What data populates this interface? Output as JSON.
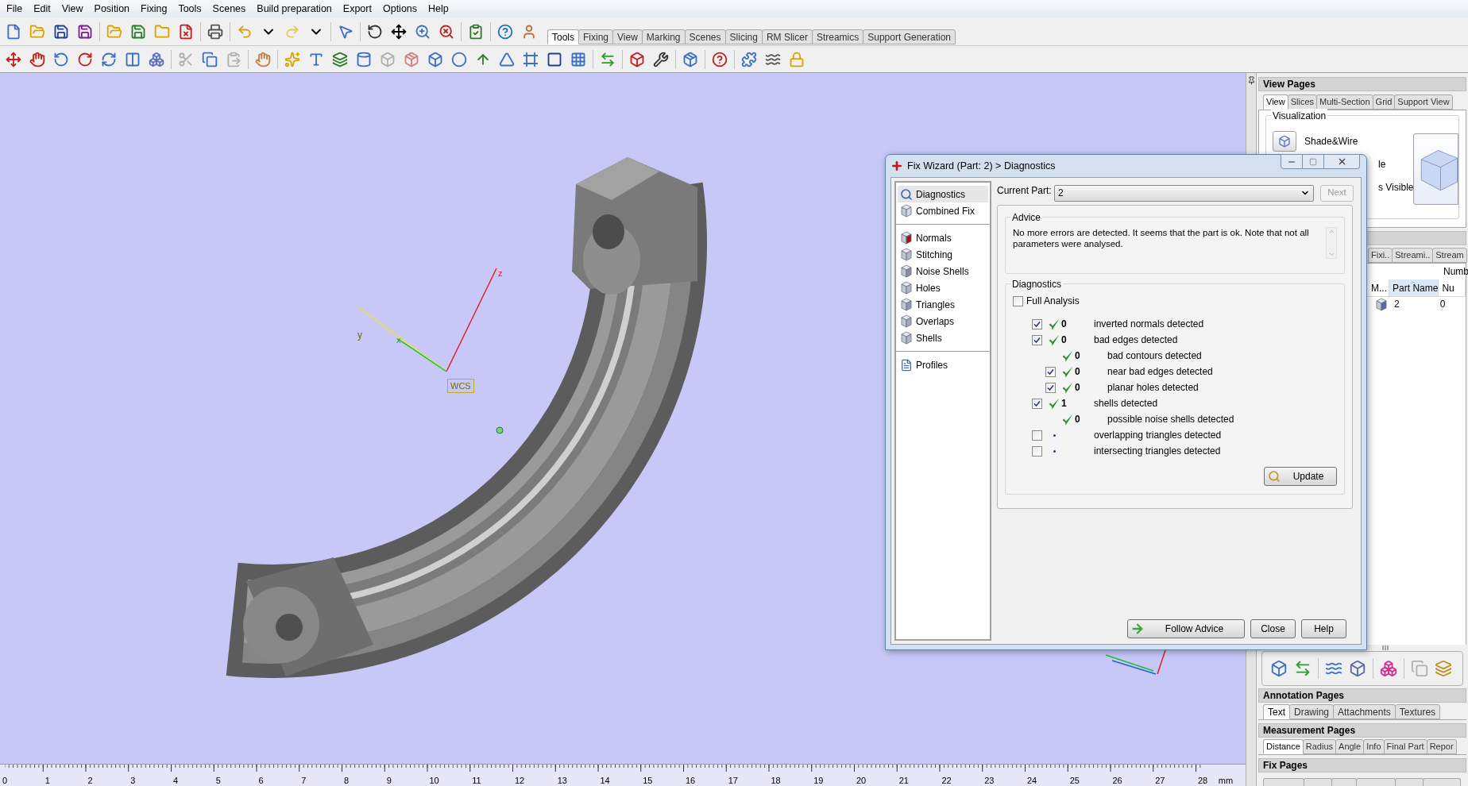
{
  "menu": [
    "File",
    "Edit",
    "View",
    "Position",
    "Fixing",
    "Tools",
    "Scenes",
    "Build preparation",
    "Export",
    "Options",
    "Help"
  ],
  "toolbar_tabs": [
    {
      "label": "Tools",
      "selected": true
    },
    {
      "label": "Fixing",
      "selected": false
    },
    {
      "label": "View",
      "selected": false
    },
    {
      "label": "Marking",
      "selected": false
    },
    {
      "label": "Scenes",
      "selected": false
    },
    {
      "label": "Slicing",
      "selected": false
    },
    {
      "label": "RM Slicer",
      "selected": false
    },
    {
      "label": "Streamics",
      "selected": false
    },
    {
      "label": "Support Generation",
      "selected": false
    }
  ],
  "viewport": {
    "wcs_label": "WCS",
    "axis_labels": {
      "z": "z",
      "y": "y",
      "x": "x"
    }
  },
  "ruler": {
    "numbers": [
      "0",
      "1",
      "2",
      "3",
      "4",
      "5",
      "6",
      "7",
      "8",
      "9",
      "10",
      "11",
      "12",
      "13",
      "14",
      "15",
      "16",
      "17",
      "18",
      "19",
      "20",
      "21",
      "22",
      "23",
      "24",
      "25",
      "26",
      "27",
      "28"
    ],
    "unit": "mm"
  },
  "right_panel": {
    "view_pages": {
      "title": "View Pages",
      "tabs": [
        {
          "label": "View",
          "selected": true
        },
        {
          "label": "Slices",
          "selected": false
        },
        {
          "label": "Multi-Section",
          "selected": false
        },
        {
          "label": "Grid",
          "selected": false
        },
        {
          "label": "Support View",
          "selected": false
        }
      ],
      "group_title": "Visualization",
      "mode_label": "Shade&Wire",
      "partial_labels": [
        "le",
        "s Visible"
      ]
    },
    "parts_pages": {
      "tabs": [
        {
          "label": "Fixi..",
          "selected": false
        },
        {
          "label": "Streami..",
          "selected": false
        },
        {
          "label": "Stream",
          "selected": false
        }
      ],
      "header_text": "Numb",
      "columns": [
        "M...",
        "Part Name",
        "Nu"
      ],
      "rows": [
        [
          "",
          "2",
          "0"
        ]
      ]
    },
    "annotation_pages": {
      "title": "Annotation Pages",
      "tabs": [
        {
          "label": "Text",
          "selected": true
        },
        {
          "label": "Drawing",
          "selected": false
        },
        {
          "label": "Attachments",
          "selected": false
        },
        {
          "label": "Textures",
          "selected": false
        }
      ]
    },
    "measurement_pages": {
      "title": "Measurement Pages",
      "tabs": [
        {
          "label": "Distance",
          "selected": true
        },
        {
          "label": "Radius",
          "selected": false
        },
        {
          "label": "Angle",
          "selected": false
        },
        {
          "label": "Info",
          "selected": false
        },
        {
          "label": "Final Part",
          "selected": false
        },
        {
          "label": "Repor",
          "selected": false
        }
      ]
    },
    "fix_pages": {
      "title": "Fix Pages"
    }
  },
  "dialog": {
    "title": "Fix Wizard (Part: 2) > Diagnostics",
    "nav_groups": [
      {
        "items": [
          {
            "label": "Diagnostics",
            "selected": true
          },
          {
            "label": "Combined Fix",
            "selected": false
          }
        ]
      },
      {
        "items": [
          {
            "label": "Normals",
            "selected": false
          },
          {
            "label": "Stitching",
            "selected": false
          },
          {
            "label": "Noise Shells",
            "selected": false
          },
          {
            "label": "Holes",
            "selected": false
          },
          {
            "label": "Triangles",
            "selected": false
          },
          {
            "label": "Overlaps",
            "selected": false
          },
          {
            "label": "Shells",
            "selected": false
          }
        ]
      },
      {
        "items": [
          {
            "label": "Profiles",
            "selected": false
          }
        ]
      }
    ],
    "current_part_label": "Current Part:",
    "current_part": "2",
    "next": {
      "label": "Next",
      "disabled": true
    },
    "advice": {
      "title": "Advice",
      "text": "No more errors are detected. It seems that the part is ok. Note that not all parameters were analysed."
    },
    "diagnostics": {
      "title": "Diagnostics",
      "full_analysis": {
        "label": "Full Analysis",
        "checked": false
      },
      "rows": [
        {
          "kind": "check",
          "checked": true,
          "ok": true,
          "count": "0",
          "label": "inverted normals detected"
        },
        {
          "kind": "check",
          "checked": true,
          "ok": true,
          "count": "0",
          "label": "bad edges detected",
          "children": [
            {
              "kind": "plain",
              "ok": true,
              "count": "0",
              "label": "bad contours detected"
            },
            {
              "kind": "check",
              "checked": true,
              "ok": true,
              "count": "0",
              "label": "near bad edges detected"
            },
            {
              "kind": "check",
              "checked": true,
              "ok": true,
              "count": "0",
              "label": "planar holes detected"
            }
          ]
        },
        {
          "kind": "check",
          "checked": true,
          "ok": true,
          "count": "1",
          "label": "shells detected",
          "children": [
            {
              "kind": "plain",
              "ok": true,
              "count": "0",
              "label": "possible noise shells detected"
            }
          ]
        },
        {
          "kind": "check",
          "checked": false,
          "ok": false,
          "label": "overlapping triangles detected"
        },
        {
          "kind": "check",
          "checked": false,
          "ok": false,
          "label": "intersecting triangles detected"
        }
      ],
      "update_label": "Update"
    },
    "buttons": [
      "Follow Advice",
      "Close",
      "Help"
    ]
  }
}
